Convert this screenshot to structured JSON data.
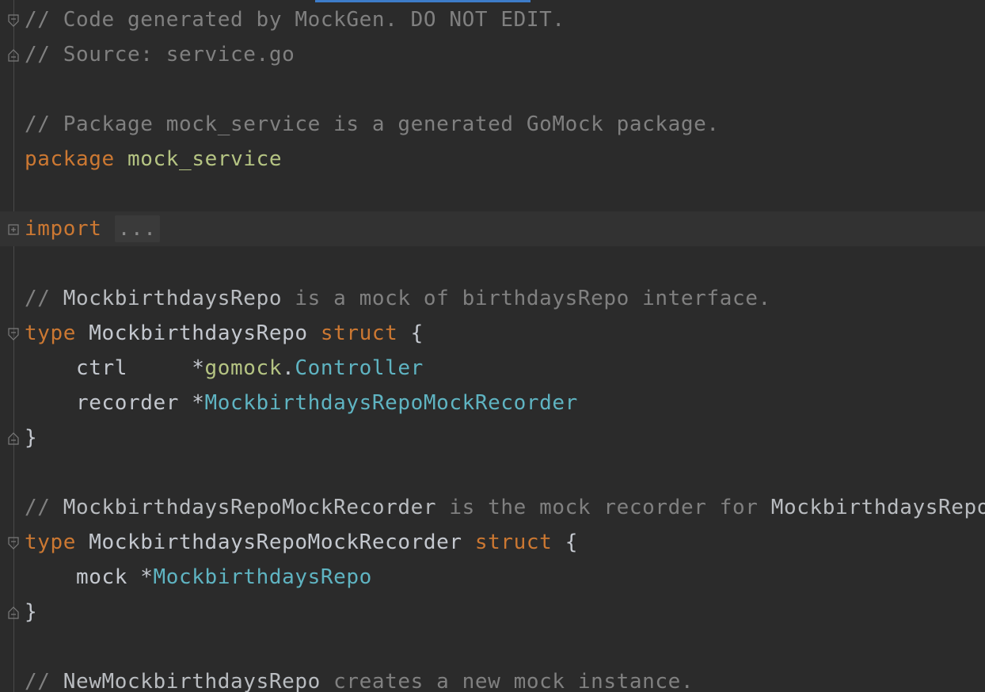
{
  "editor": {
    "lines": [
      {
        "fold": "open",
        "highlight": false,
        "tokens": [
          {
            "text": "// Code generated by MockGen. DO NOT EDIT.",
            "cls": "t-comment"
          }
        ]
      },
      {
        "fold": "end",
        "highlight": false,
        "tokens": [
          {
            "text": "// Source: service.go",
            "cls": "t-comment"
          }
        ]
      },
      {
        "fold": "",
        "highlight": false,
        "tokens": []
      },
      {
        "fold": "",
        "highlight": false,
        "tokens": [
          {
            "text": "// Package mock_service is a generated GoMock package.",
            "cls": "t-comment"
          }
        ]
      },
      {
        "fold": "",
        "highlight": false,
        "tokens": [
          {
            "text": "package",
            "cls": "t-keyword"
          },
          {
            "text": " ",
            "cls": "t-plain"
          },
          {
            "text": "mock_service",
            "cls": "t-pkg"
          }
        ]
      },
      {
        "fold": "",
        "highlight": false,
        "tokens": []
      },
      {
        "fold": "collapsed",
        "highlight": true,
        "tokens": [
          {
            "text": "import",
            "cls": "t-keyword"
          },
          {
            "text": " ",
            "cls": "t-plain"
          },
          {
            "text": "...",
            "cls": "collapsed"
          }
        ]
      },
      {
        "fold": "",
        "highlight": false,
        "tokens": []
      },
      {
        "fold": "",
        "highlight": false,
        "tokens": [
          {
            "text": "// ",
            "cls": "t-comment"
          },
          {
            "text": "MockbirthdaysRepo",
            "cls": "t-comment-ref"
          },
          {
            "text": " is a mock of birthdaysRepo interface.",
            "cls": "t-comment"
          }
        ]
      },
      {
        "fold": "open",
        "highlight": false,
        "tokens": [
          {
            "text": "type",
            "cls": "t-keyword"
          },
          {
            "text": " ",
            "cls": "t-plain"
          },
          {
            "text": "MockbirthdaysRepo",
            "cls": "t-ident"
          },
          {
            "text": " ",
            "cls": "t-plain"
          },
          {
            "text": "struct",
            "cls": "t-keyword"
          },
          {
            "text": " {",
            "cls": "t-punct"
          }
        ]
      },
      {
        "fold": "",
        "highlight": false,
        "tokens": [
          {
            "text": "    ctrl     *",
            "cls": "t-ident"
          },
          {
            "text": "gomock",
            "cls": "t-pkg"
          },
          {
            "text": ".",
            "cls": "t-punct"
          },
          {
            "text": "Controller",
            "cls": "t-type"
          }
        ]
      },
      {
        "fold": "",
        "highlight": false,
        "tokens": [
          {
            "text": "    recorder *",
            "cls": "t-ident"
          },
          {
            "text": "MockbirthdaysRepoMockRecorder",
            "cls": "t-type"
          }
        ]
      },
      {
        "fold": "end",
        "highlight": false,
        "tokens": [
          {
            "text": "}",
            "cls": "t-punct"
          }
        ]
      },
      {
        "fold": "",
        "highlight": false,
        "tokens": []
      },
      {
        "fold": "",
        "highlight": false,
        "tokens": [
          {
            "text": "// ",
            "cls": "t-comment"
          },
          {
            "text": "MockbirthdaysRepoMockRecorder",
            "cls": "t-comment-ref"
          },
          {
            "text": " is the mock recorder for ",
            "cls": "t-comment"
          },
          {
            "text": "MockbirthdaysRepo",
            "cls": "t-comment-ref"
          },
          {
            "text": ".",
            "cls": "t-comment"
          }
        ]
      },
      {
        "fold": "open",
        "highlight": false,
        "tokens": [
          {
            "text": "type",
            "cls": "t-keyword"
          },
          {
            "text": " ",
            "cls": "t-plain"
          },
          {
            "text": "MockbirthdaysRepoMockRecorder",
            "cls": "t-ident"
          },
          {
            "text": " ",
            "cls": "t-plain"
          },
          {
            "text": "struct",
            "cls": "t-keyword"
          },
          {
            "text": " {",
            "cls": "t-punct"
          }
        ]
      },
      {
        "fold": "",
        "highlight": false,
        "tokens": [
          {
            "text": "    mock *",
            "cls": "t-ident"
          },
          {
            "text": "MockbirthdaysRepo",
            "cls": "t-type"
          }
        ]
      },
      {
        "fold": "end",
        "highlight": false,
        "tokens": [
          {
            "text": "}",
            "cls": "t-punct"
          }
        ]
      },
      {
        "fold": "",
        "highlight": false,
        "tokens": []
      },
      {
        "fold": "",
        "highlight": false,
        "tokens": [
          {
            "text": "// ",
            "cls": "t-comment"
          },
          {
            "text": "NewMockbirthdaysRepo",
            "cls": "t-comment-ref"
          },
          {
            "text": " creates a new mock instance.",
            "cls": "t-comment"
          }
        ]
      }
    ]
  }
}
